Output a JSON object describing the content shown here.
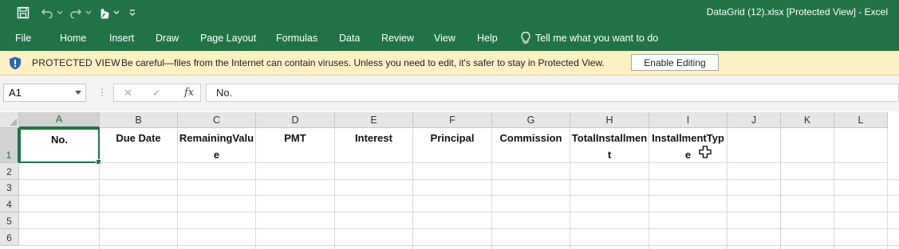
{
  "app": {
    "title": "DataGrid (12).xlsx  [Protected View]  -  Excel",
    "accent": "#217346"
  },
  "quick_access": {
    "icons": [
      "save-icon",
      "undo-icon",
      "redo-icon",
      "touch-mode-icon",
      "customize-icon"
    ]
  },
  "ribbon": {
    "tabs": [
      {
        "label": "File"
      },
      {
        "label": "Home"
      },
      {
        "label": "Insert"
      },
      {
        "label": "Draw"
      },
      {
        "label": "Page Layout"
      },
      {
        "label": "Formulas"
      },
      {
        "label": "Data"
      },
      {
        "label": "Review"
      },
      {
        "label": "View"
      },
      {
        "label": "Help"
      }
    ],
    "tell_me": "Tell me what you want to do"
  },
  "protected_view": {
    "label": "PROTECTED VIEW",
    "message": "Be careful—files from the Internet can contain viruses. Unless you need to edit, it's safer to stay in Protected View.",
    "button": "Enable Editing",
    "bg_color": "#fdf0c2"
  },
  "formula_bar": {
    "name_box": "A1",
    "fx": "fx",
    "value": "No."
  },
  "sheet": {
    "columns": [
      "A",
      "B",
      "C",
      "D",
      "E",
      "F",
      "G",
      "H",
      "I",
      "J",
      "K",
      "L"
    ],
    "rows": [
      "1",
      "2",
      "3",
      "4",
      "5",
      "6"
    ],
    "selected_cell": "A1",
    "header_row": [
      "No.",
      "Due Date",
      "RemainingValue",
      "PMT",
      "Interest",
      "Principal",
      "Commission",
      "TotalInstallment",
      "InstallmentType",
      "",
      "",
      ""
    ]
  }
}
